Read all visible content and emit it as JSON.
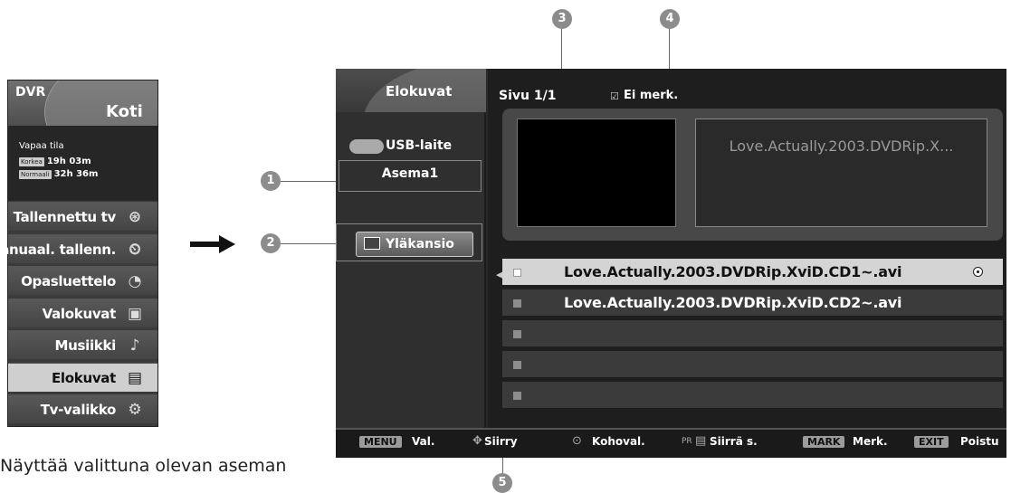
{
  "dvr_menu": {
    "title": "DVR",
    "home": "Koti",
    "free_space_label": "Vapaa tila",
    "quality": [
      {
        "badge": "Korkea",
        "time": "19h 03m"
      },
      {
        "badge": "Normaali",
        "time": "32h 36m"
      }
    ],
    "items": [
      {
        "label": "Tallennettu tv",
        "icon": "film-reel-icon",
        "glyph": "⊛"
      },
      {
        "label": "Manuaal. tallenn.",
        "icon": "timer-record-icon",
        "glyph": "⏲"
      },
      {
        "label": "Opasluettelo",
        "icon": "guide-clock-icon",
        "glyph": "◔"
      },
      {
        "label": "Valokuvat",
        "icon": "photo-icon",
        "glyph": "▣"
      },
      {
        "label": "Musiikki",
        "icon": "music-note-icon",
        "glyph": "♪"
      },
      {
        "label": "Elokuvat",
        "icon": "movie-file-icon",
        "glyph": "▤"
      },
      {
        "label": "Tv-valikko",
        "icon": "settings-gears-icon",
        "glyph": "⚙"
      }
    ],
    "selected_index": 5
  },
  "screen": {
    "section_title": "Elokuvat",
    "device_label": "USB-laite",
    "drive_label": "Asema1",
    "up_folder_label": "Yläkansio",
    "page_label": "Sivu 1/1",
    "mark_label": "Ei merk.",
    "preview_title": "Love.Actually.2003.DVDRip.X...",
    "files": [
      {
        "name": "Love.Actually.2003.DVDRip.XviD.CD1~.avi",
        "selected": true
      },
      {
        "name": "Love.Actually.2003.DVDRip.XviD.CD2~.avi",
        "selected": false
      },
      {
        "name": "",
        "selected": false
      },
      {
        "name": "",
        "selected": false
      },
      {
        "name": "",
        "selected": false
      }
    ]
  },
  "bottom_bar": {
    "menu_key": "MENU",
    "menu_hint": "Val.",
    "move_hint": "Siirry",
    "select_hint": "Kohoval.",
    "pr_key": "PR",
    "page_hint": "Siirrä s.",
    "mark_key": "MARK",
    "mark_hint": "Merk.",
    "exit_key": "EXIT",
    "exit_hint": "Poistu"
  },
  "callouts": [
    "1",
    "2",
    "3",
    "4",
    "5"
  ],
  "caption": "Näyttää valittuna olevan aseman"
}
